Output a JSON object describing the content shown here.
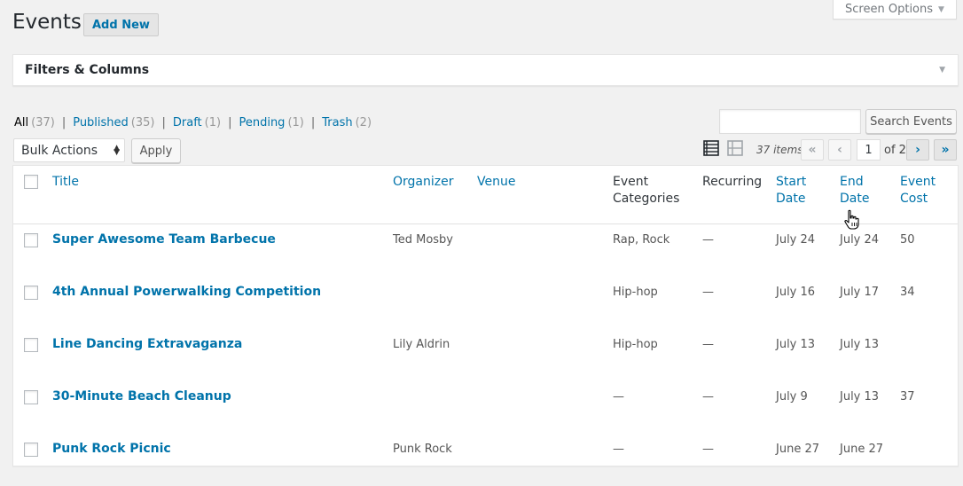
{
  "screen_options": {
    "label": "Screen Options"
  },
  "header": {
    "title": "Events",
    "add_new": "Add New"
  },
  "filters_panel": {
    "title": "Filters & Columns"
  },
  "views": [
    {
      "label": "All",
      "count": "(37)"
    },
    {
      "label": "Published",
      "count": "(35)"
    },
    {
      "label": "Draft",
      "count": "(1)"
    },
    {
      "label": "Pending",
      "count": "(1)"
    },
    {
      "label": "Trash",
      "count": "(2)"
    }
  ],
  "search": {
    "button": "Search Events",
    "value": ""
  },
  "bulk": {
    "selected": "Bulk Actions",
    "apply": "Apply"
  },
  "pagination": {
    "items": "37 items",
    "first": "«",
    "prev": "‹",
    "next": "›",
    "last": "»",
    "current": "1",
    "of": "of 2"
  },
  "columns": {
    "title": "Title",
    "organizer": "Organizer",
    "venue": "Venue",
    "categories": "Event Categories",
    "recurring": "Recurring",
    "start": "Start Date",
    "end": "End Date",
    "cost": "Event Cost"
  },
  "rows": [
    {
      "title": "Super Awesome Team Barbecue",
      "organizer": "Ted Mosby",
      "venue": "",
      "categories": "Rap, Rock",
      "recurring": "—",
      "start": "July 24",
      "end": "July 24",
      "cost": "50"
    },
    {
      "title": "4th Annual Powerwalking Competition",
      "organizer": "",
      "venue": "",
      "categories": "Hip-hop",
      "recurring": "—",
      "start": "July 16",
      "end": "July 17",
      "cost": "34"
    },
    {
      "title": "Line Dancing Extravaganza",
      "organizer": "Lily Aldrin",
      "venue": "",
      "categories": "Hip-hop",
      "recurring": "—",
      "start": "July 13",
      "end": "July 13",
      "cost": ""
    },
    {
      "title": "30-Minute Beach Cleanup",
      "organizer": "",
      "venue": "",
      "categories": "—",
      "recurring": "—",
      "start": "July 9",
      "end": "July 13",
      "cost": "37"
    },
    {
      "title": "Punk Rock Picnic",
      "organizer": "Punk Rock",
      "venue": "",
      "categories": "—",
      "recurring": "—",
      "start": "June 27",
      "end": "June 27",
      "cost": ""
    }
  ],
  "colors": {
    "link": "#0073aa",
    "background": "#f1f1f1",
    "panel": "#ffffff"
  },
  "icons": [
    "list-view-icon",
    "excerpt-view-icon",
    "triangle-down-icon",
    "hand-cursor-icon"
  ]
}
